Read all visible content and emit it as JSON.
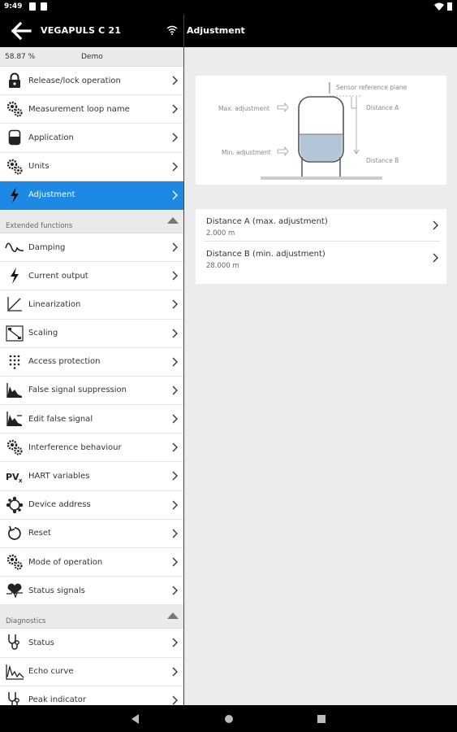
{
  "status_bar": {
    "time": "9:49"
  },
  "left_header": {
    "device_title": "VEGAPULS C 21"
  },
  "right_header": {
    "title": "Adjustment"
  },
  "info": {
    "percent": "58.87 %",
    "mode": "Demo"
  },
  "main_items": [
    {
      "label": "Release/lock operation",
      "icon": "lock-icon"
    },
    {
      "label": "Measurement loop name",
      "icon": "gears-icon"
    },
    {
      "label": "Application",
      "icon": "container-icon"
    },
    {
      "label": "Units",
      "icon": "gears-icon"
    },
    {
      "label": "Adjustment",
      "icon": "lightning-icon",
      "active": true
    }
  ],
  "extended": {
    "header": "Extended functions",
    "items": [
      {
        "label": "Damping",
        "icon": "wave-icon"
      },
      {
        "label": "Current output",
        "icon": "lightning-icon"
      },
      {
        "label": "Linearization",
        "icon": "linearization-icon"
      },
      {
        "label": "Scaling",
        "icon": "scaling-icon"
      },
      {
        "label": "Access protection",
        "icon": "keypad-icon"
      },
      {
        "label": "False signal suppression",
        "icon": "false-signal-icon"
      },
      {
        "label": "Edit false signal",
        "icon": "edit-false-signal-icon"
      },
      {
        "label": "Interference behaviour",
        "icon": "gears-icon"
      },
      {
        "label": "HART variables",
        "icon": "pv-icon"
      },
      {
        "label": "Device address",
        "icon": "network-icon"
      },
      {
        "label": "Reset",
        "icon": "reset-icon"
      },
      {
        "label": "Mode of operation",
        "icon": "gears-icon"
      },
      {
        "label": "Status signals",
        "icon": "heart-pulse-icon"
      }
    ]
  },
  "diagnostics": {
    "header": "Diagnostics",
    "items": [
      {
        "label": "Status",
        "icon": "stethoscope-icon"
      },
      {
        "label": "Echo curve",
        "icon": "echo-curve-icon"
      },
      {
        "label": "Peak indicator",
        "icon": "stethoscope-icon"
      }
    ]
  },
  "diagram": {
    "sensor_reference_plane": "Sensor reference plane",
    "max_adjustment": "Max. adjustment",
    "min_adjustment": "Min. adjustment",
    "distance_a": "Distance A",
    "distance_b": "Distance B"
  },
  "adjustment_list": [
    {
      "title": "Distance A (max. adjustment)",
      "value": "2.000 m"
    },
    {
      "title": "Distance B (min. adjustment)",
      "value": "28.000 m"
    }
  ],
  "colors": {
    "accent": "#1e88e5",
    "background": "#ececec",
    "bar": "#000000"
  }
}
